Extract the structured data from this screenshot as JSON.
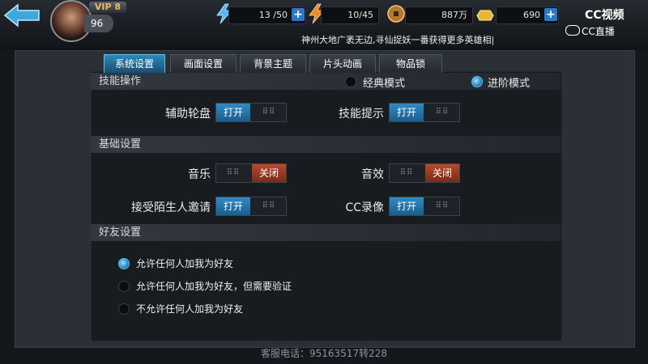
{
  "header": {
    "vip": "VIP 8",
    "level": "96",
    "resources": [
      {
        "name": "stamina",
        "icon": "lightning-blue-icon",
        "value": "13 /50"
      },
      {
        "name": "energy",
        "icon": "lightning-orange-icon",
        "value": "10/45"
      },
      {
        "name": "coins",
        "icon": "copper-coin-icon",
        "value": "887万"
      },
      {
        "name": "gold",
        "icon": "gold-ingot-icon",
        "value": "690"
      }
    ],
    "notice": "神州大地广袤无边,寻仙捉妖一番获得更多英雄相|",
    "watermark_title": "CC视频",
    "watermark_sub": "CC直播"
  },
  "tabs": [
    {
      "label": "系统设置",
      "active": true
    },
    {
      "label": "画面设置",
      "active": false
    },
    {
      "label": "背景主题",
      "active": false
    },
    {
      "label": "片头动画",
      "active": false
    },
    {
      "label": "物品锁",
      "active": false
    }
  ],
  "skill": {
    "title": "技能操作",
    "mode_classic": "经典模式",
    "mode_advanced": "进阶模式",
    "selected_mode": "进阶模式",
    "assist_wheel": {
      "label": "辅助轮盘",
      "state": "打开"
    },
    "skill_hint": {
      "label": "技能提示",
      "state": "打开"
    }
  },
  "basic": {
    "title": "基础设置",
    "music": {
      "label": "音乐",
      "state": "关闭"
    },
    "sfx": {
      "label": "音效",
      "state": "关闭"
    },
    "stranger_invite": {
      "label": "接受陌生人邀请",
      "state": "打开"
    },
    "cc_record": {
      "label": "CC录像",
      "state": "打开"
    }
  },
  "friends": {
    "title": "好友设置",
    "options": [
      "允许任何人加我为好友",
      "允许任何人加我为好友，但需要验证",
      "不允许任何人加我为好友"
    ],
    "selected_index": 0
  },
  "footer": {
    "service_phone": "客服电话：95163517转228"
  }
}
